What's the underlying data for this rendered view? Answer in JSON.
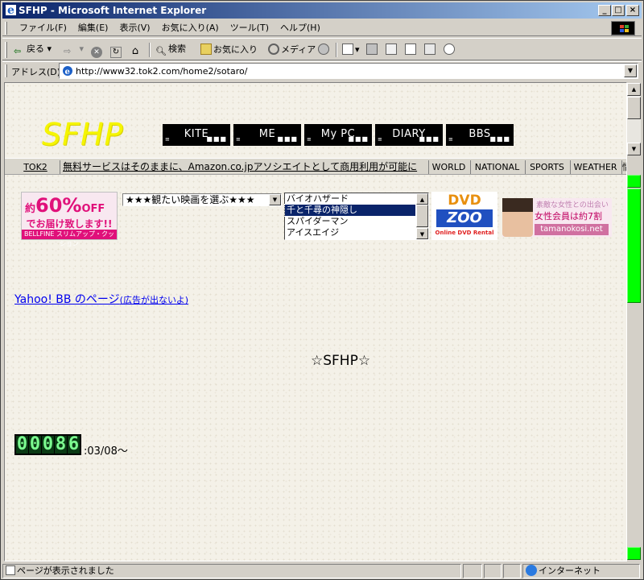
{
  "window": {
    "title": "SFHP - Microsoft Internet Explorer"
  },
  "menu": {
    "items": [
      "ファイル(F)",
      "編集(E)",
      "表示(V)",
      "お気に入り(A)",
      "ツール(T)",
      "ヘルプ(H)"
    ]
  },
  "toolbar": {
    "back": "戻る",
    "search": "検索",
    "favorites": "お気に入り",
    "media": "メディア"
  },
  "address": {
    "label": "アドレス(D)",
    "url": "http://www32.tok2.com/home2/sotaro/"
  },
  "page": {
    "logo": "SFHP",
    "nav": [
      "KITE",
      "ME",
      "My PC",
      "DIARY",
      "BBS"
    ],
    "adbar": {
      "host": "TOK2",
      "message": "無料サービスはそのままに、Amazon.co.jpアソシエイトとして商用利用が可能に",
      "links": [
        "WORLD",
        "NATIONAL",
        "SPORTS",
        "WEATHER",
        "情"
      ]
    },
    "banner_bellfine": {
      "line1_prefix": "約",
      "line1": "60%",
      "line1_suffix": "OFF",
      "line2": "でお届け致します!!",
      "line3": "BELLFINE スリムアップ・クッション"
    },
    "movie_select": {
      "selected": "★★★観たい映画を選ぶ★★★"
    },
    "movie_list": {
      "options": [
        "バイオハザード",
        "千と千尋の神隠し",
        "スパイダーマン",
        "アイスエイジ"
      ],
      "selected_index": 1
    },
    "banner_dvd": {
      "top": "DVD",
      "middle": "ZOO",
      "bottom": "Online DVD Rental"
    },
    "banner_tamanokosi": {
      "line1": "素敵な女性との出会い",
      "line2": "女性会員は約7割",
      "line3": "tamanokosi.net"
    },
    "yahoo_link": {
      "text": "Yahoo! BB のページ",
      "note": "(広告が出ないよ)"
    },
    "center_title": "☆SFHP☆",
    "counter": {
      "digits": [
        "0",
        "0",
        "0",
        "8",
        "6"
      ],
      "since": ":03/08〜"
    }
  },
  "status": {
    "text": "ページが表示されました",
    "zone": "インターネット"
  },
  "colors": {
    "logo": "#f5f500",
    "titlebar": "#0a246a",
    "scroll_thumb": "#00ff00",
    "counter": "#7cfc90"
  }
}
